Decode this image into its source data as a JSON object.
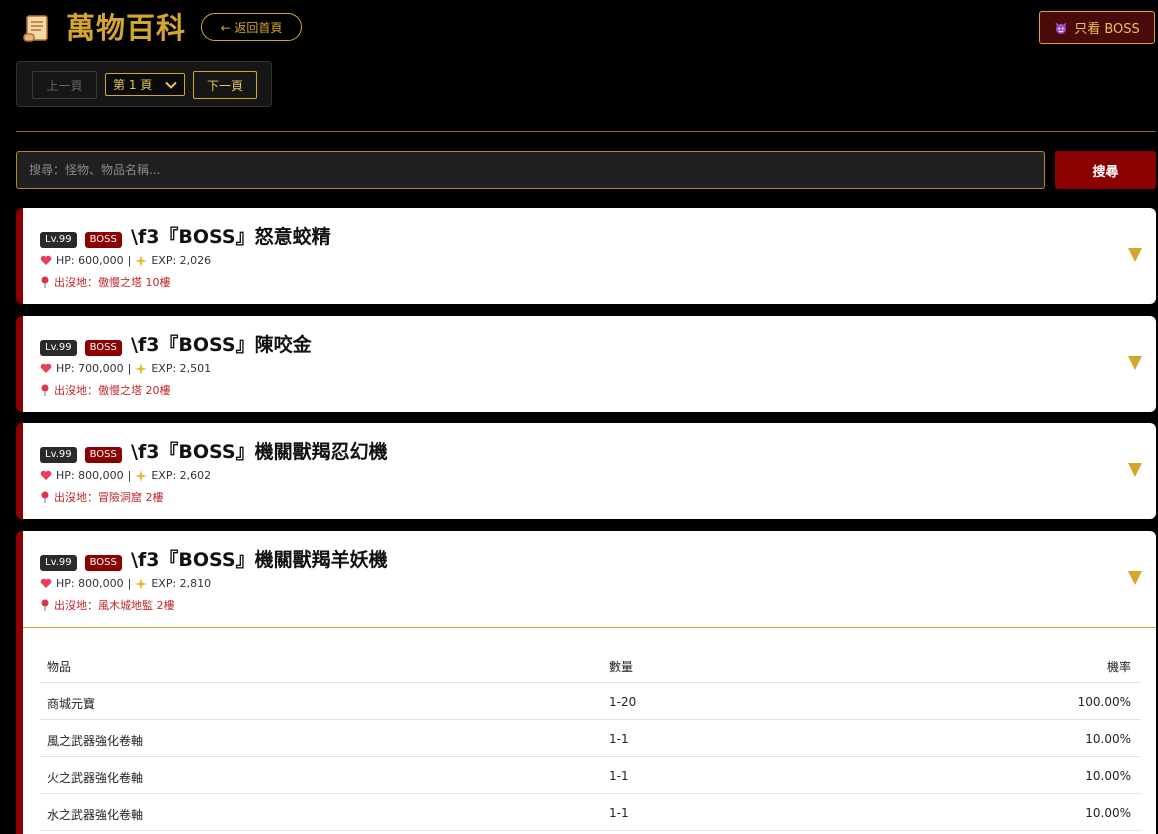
{
  "header": {
    "title": "萬物百科",
    "back_label": "← 返回首頁",
    "boss_only_label": "只看 BOSS"
  },
  "pager": {
    "prev_label": "上一頁",
    "page_label": "第 1 頁",
    "next_label": "下一頁"
  },
  "search": {
    "placeholder": "搜尋：怪物、物品名稱...",
    "button_label": "搜尋"
  },
  "monsters": [
    {
      "level": "Lv.99",
      "tag": "BOSS",
      "name": "\\f3『BOSS』怒意蛟精",
      "hp": "HP: 600,000",
      "exp": "EXP: 2,026",
      "location": "出沒地：傲慢之塔 10樓"
    },
    {
      "level": "Lv.99",
      "tag": "BOSS",
      "name": "\\f3『BOSS』陳咬金",
      "hp": "HP: 700,000",
      "exp": "EXP: 2,501",
      "location": "出沒地：傲慢之塔 20樓"
    },
    {
      "level": "Lv.99",
      "tag": "BOSS",
      "name": "\\f3『BOSS』機關獸羯忍幻機",
      "hp": "HP: 800,000",
      "exp": "EXP: 2,602",
      "location": "出沒地：冒險洞窟 2樓"
    },
    {
      "level": "Lv.99",
      "tag": "BOSS",
      "name": "\\f3『BOSS』機關獸羯羊妖機",
      "hp": "HP: 800,000",
      "exp": "EXP: 2,810",
      "location": "出沒地：風木城地監 2樓"
    }
  ],
  "drops": {
    "headers": [
      "物品",
      "數量",
      "機率"
    ],
    "rows": [
      [
        "商城元寶",
        "1-20",
        "100.00%"
      ],
      [
        "風之武器強化卷軸",
        "1-1",
        "10.00%"
      ],
      [
        "火之武器強化卷軸",
        "1-1",
        "10.00%"
      ],
      [
        "水之武器強化卷軸",
        "1-1",
        "10.00%"
      ]
    ]
  },
  "colors": {
    "accent_gold": "#d4a52f",
    "boss_red": "#8b0000",
    "location_red": "#c0282b"
  }
}
